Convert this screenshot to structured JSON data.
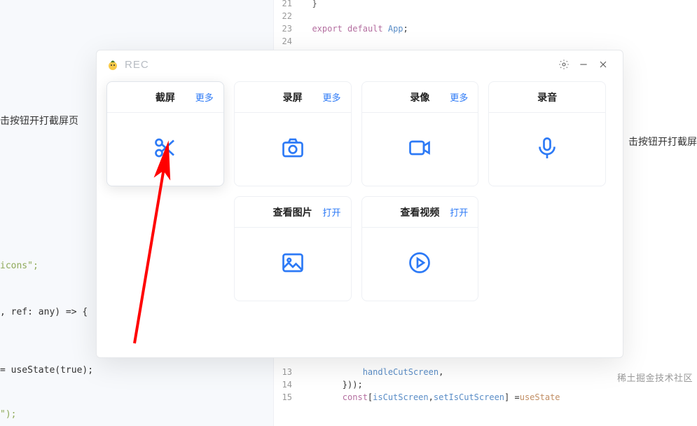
{
  "app": {
    "title": "REC"
  },
  "titlebar": {
    "settings_name": "settings",
    "minimize_name": "minimize",
    "close_name": "close"
  },
  "cards": [
    {
      "title": "截屏",
      "more": "更多",
      "icon": "scissors-icon",
      "active": true
    },
    {
      "title": "录屏",
      "more": "更多",
      "icon": "camera-icon"
    },
    {
      "title": "录像",
      "more": "更多",
      "icon": "video-icon"
    },
    {
      "title": "录音",
      "more": "",
      "icon": "mic-icon"
    },
    {
      "title": "查看图片",
      "more": "打开",
      "icon": "image-icon",
      "row": 2
    },
    {
      "title": "查看视频",
      "more": "打开",
      "icon": "play-icon",
      "row": 2
    }
  ],
  "bg_left": {
    "instruction": "击按钮开打截屏页",
    "l_icons": "icons\";",
    "l_ref": ", ref: any) => {",
    "l_useState": "= useState(true);",
    "l_end": "\");"
  },
  "bg_right_cut": "击按钮开打截屏",
  "code_top": [
    {
      "n": "21",
      "t": "}"
    },
    {
      "n": "22",
      "t": ""
    },
    {
      "n": "23",
      "t": "export default App;"
    },
    {
      "n": "24",
      "t": ""
    }
  ],
  "code_bottom": [
    {
      "n": "13",
      "t": "            handleCutScreen,"
    },
    {
      "n": "14",
      "t": "        }));"
    },
    {
      "n": "15",
      "t": "        const [isCutScreen, setIsCutScreen] = useState"
    }
  ],
  "watermark": "稀土掘金技术社区"
}
